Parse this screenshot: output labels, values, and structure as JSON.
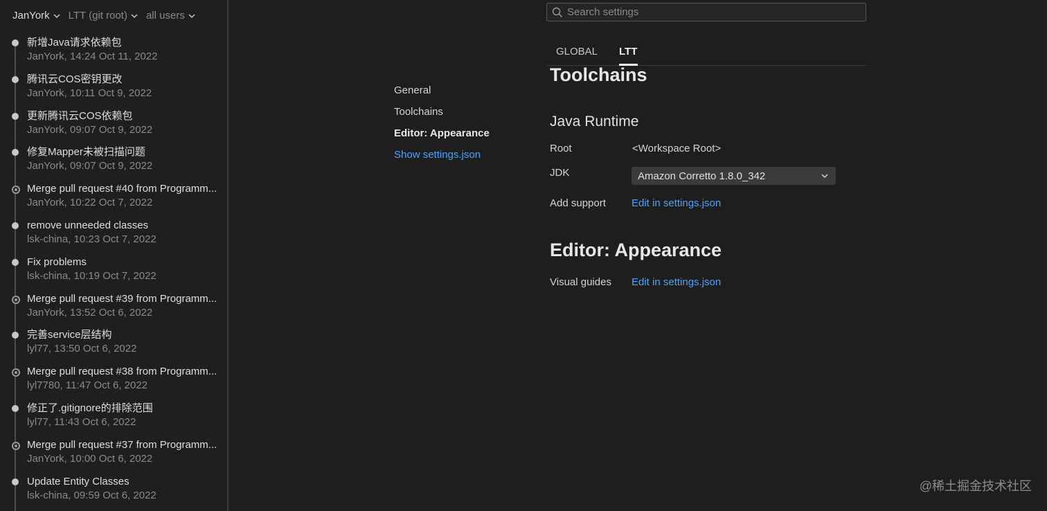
{
  "filters": {
    "author": "JanYork",
    "branch": "LTT (git root)",
    "users": "all users"
  },
  "commits": [
    {
      "message": "新增Java请求依赖包",
      "meta": "JanYork, 14:24 Oct 11, 2022",
      "merge": false
    },
    {
      "message": "腾讯云COS密钥更改",
      "meta": "JanYork, 10:11 Oct 9, 2022",
      "merge": false
    },
    {
      "message": "更新腾讯云COS依赖包",
      "meta": "JanYork, 09:07 Oct 9, 2022",
      "merge": false
    },
    {
      "message": "修复Mapper未被扫描问题",
      "meta": "JanYork, 09:07 Oct 9, 2022",
      "merge": false
    },
    {
      "message": "Merge pull request #40 from Programm...",
      "meta": "JanYork, 10:22 Oct 7, 2022",
      "merge": true
    },
    {
      "message": "remove unneeded classes",
      "meta": "lsk-china, 10:23 Oct 7, 2022",
      "merge": false
    },
    {
      "message": "Fix problems",
      "meta": "lsk-china, 10:19 Oct 7, 2022",
      "merge": false
    },
    {
      "message": "Merge pull request #39 from Programm...",
      "meta": "JanYork, 13:52 Oct 6, 2022",
      "merge": true
    },
    {
      "message": "完善service层结构",
      "meta": "lyl77, 13:50 Oct 6, 2022",
      "merge": false
    },
    {
      "message": "Merge pull request #38 from Programm...",
      "meta": "lyl7780, 11:47 Oct 6, 2022",
      "merge": true
    },
    {
      "message": "修正了.gitignore的排除范围",
      "meta": "lyl77, 11:43 Oct 6, 2022",
      "merge": false
    },
    {
      "message": "Merge pull request #37 from Programm...",
      "meta": "JanYork, 10:00 Oct 6, 2022",
      "merge": true
    },
    {
      "message": "Update Entity Classes",
      "meta": "lsk-china, 09:59 Oct 6, 2022",
      "merge": false
    }
  ],
  "nav": {
    "items": [
      "General",
      "Toolchains",
      "Editor: Appearance"
    ],
    "active_index": 2,
    "show_json": "Show settings.json"
  },
  "search": {
    "placeholder": "Search settings"
  },
  "tabs": {
    "global": "GLOBAL",
    "ltt": "LTT"
  },
  "toolchains": {
    "title": "Toolchains",
    "runtime_title": "Java Runtime",
    "root_label": "Root",
    "root_value": "<Workspace Root>",
    "jdk_label": "JDK",
    "jdk_value": "Amazon Corretto 1.8.0_342",
    "add_support_label": "Add support",
    "add_support_link": "Edit in settings.json"
  },
  "appearance": {
    "title": "Editor: Appearance",
    "visual_guides_label": "Visual guides",
    "visual_guides_link": "Edit in settings.json"
  },
  "watermark": "@稀土掘金技术社区",
  "colors": {
    "accent_link": "#4aa3ff",
    "background": "#1e1e1e"
  }
}
